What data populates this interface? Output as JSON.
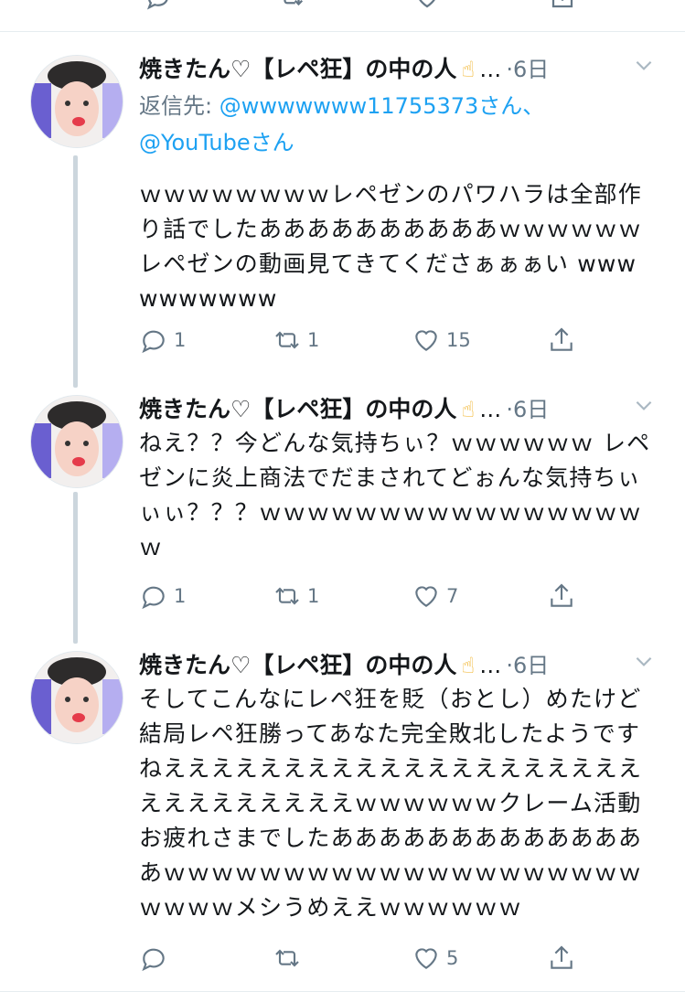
{
  "colors": {
    "text": "#14171a",
    "secondary": "#657786",
    "link": "#1da1f2",
    "thread_line": "#ccd6dd",
    "divider": "#e6ecf0"
  },
  "tweets": [
    {
      "display_name": "焼きたん♡【レペ狂】の中の人",
      "emoji": "☝",
      "more": "…",
      "time": "·6日",
      "reply_prefix": "返信先: ",
      "reply_handle1": "@wwwwwww11755373さん",
      "reply_sep": "、",
      "reply_handle2": "@YouTubeさん",
      "text": "ｗｗｗｗｗｗｗｗレペゼンのパワハラは全部作り話でしたああああああああああｗｗｗｗｗｗレペゼンの動画見てきてくださぁぁぁい wwwwwwwwww",
      "actions": {
        "reply": "1",
        "retweet": "1",
        "like": "15"
      }
    },
    {
      "display_name": "焼きたん♡【レペ狂】の中の人",
      "emoji": "☝",
      "more": "…",
      "time": "·6日",
      "text": "ねえ？？今どんな気持ちぃ？ｗｗｗｗｗｗ レペゼンに炎上商法でだまされてどぉんな気持ちぃぃぃ？？？ｗｗｗｗｗｗｗｗｗｗｗｗｗｗｗｗｗ",
      "actions": {
        "reply": "1",
        "retweet": "1",
        "like": "7"
      }
    },
    {
      "display_name": "焼きたん♡【レペ狂】の中の人",
      "emoji": "☝",
      "more": "…",
      "time": "·6日",
      "text": "そしてこんなにレペ狂を貶（おとし）めたけど結局レペ狂勝ってあなた完全敗北したようですねえええええええええええええええええええええええええええええｗｗｗｗｗｗクレーム活動お疲れさまでしたああああああああああああああｗｗｗｗｗｗｗｗｗｗｗｗｗｗｗｗｗｗｗｗｗｗｗｗメシうめええｗｗｗｗｗｗ",
      "actions": {
        "reply": "",
        "retweet": "",
        "like": "5"
      }
    }
  ],
  "icons": {
    "reply": "reply-icon",
    "retweet": "retweet-icon",
    "like": "heart-icon",
    "share": "share-icon",
    "caret": "chevron-down-icon"
  }
}
